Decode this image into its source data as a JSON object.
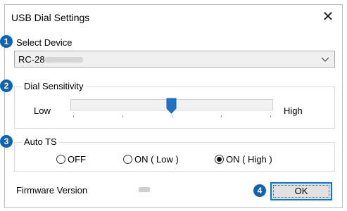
{
  "window": {
    "title": "USB Dial Settings",
    "close_glyph": "✕"
  },
  "badges": [
    "1",
    "2",
    "3",
    "4"
  ],
  "device": {
    "label": "Select Device",
    "value": "RC-28"
  },
  "dial": {
    "legend": "Dial Sensitivity",
    "low_label": "Low",
    "high_label": "High",
    "level_fraction": 0.5
  },
  "auto_ts": {
    "legend": "Auto TS",
    "options": [
      {
        "label": "OFF",
        "selected": false
      },
      {
        "label": "ON ( Low )",
        "selected": false
      },
      {
        "label": "ON ( High )",
        "selected": true
      }
    ]
  },
  "firmware": {
    "label": "Firmware Version"
  },
  "ok_button": {
    "label": "OK"
  },
  "colors": {
    "accent": "#0078d7",
    "badge": "#0d63b4",
    "slider_thumb": "#1e72c8"
  }
}
